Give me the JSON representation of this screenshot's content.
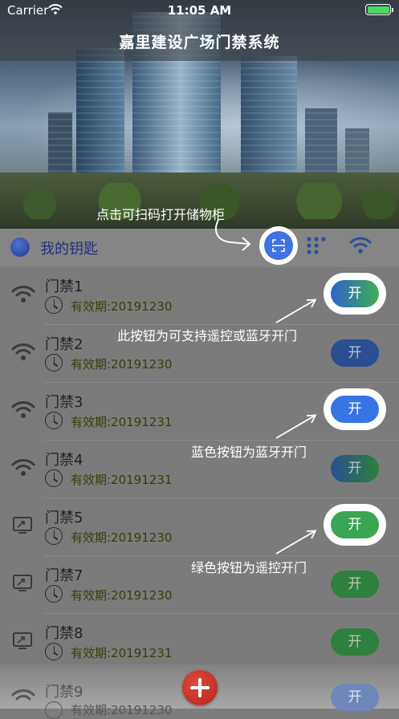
{
  "status_bar": {
    "carrier": "Carrier",
    "time": "11:05 AM"
  },
  "header": {
    "title": "嘉里建设广场门禁系统"
  },
  "tips": {
    "scan": "点击可扫码打开储物柜",
    "remote_or_bluetooth": "此按钮为可支持遥控或蓝牙开门",
    "bluetooth": "蓝色按钮为蓝牙开门",
    "remote": "绿色按钮为遥控开门"
  },
  "keys_header": {
    "label": "我的钥匙"
  },
  "open_label": "开",
  "keys": [
    {
      "name": "门禁1",
      "validity": "有效期:20191230",
      "icon": "wifi-icon",
      "button_color": "#3a8cc8"
    },
    {
      "name": "门禁2",
      "validity": "有效期:20191230",
      "icon": "wifi-icon",
      "button_color": "#2a4e8f"
    },
    {
      "name": "门禁3",
      "validity": "有效期:20191231",
      "icon": "wifi-icon",
      "button_color": "#3875e4"
    },
    {
      "name": "门禁4",
      "validity": "有效期:20191231",
      "icon": "wifi-icon",
      "button_color": "#29508f"
    },
    {
      "name": "门禁5",
      "validity": "有效期:20191230",
      "icon": "remote-screen-icon",
      "button_color": "#3aa552"
    },
    {
      "name": "门禁7",
      "validity": "有效期:20191230",
      "icon": "remote-screen-icon",
      "button_color": "#2f7f3d"
    },
    {
      "name": "门禁8",
      "validity": "有效期:20191231",
      "icon": "remote-screen-icon",
      "button_color": "#2f7f3d"
    },
    {
      "name": "门禁9",
      "validity": "有效期:20191230",
      "icon": "wifi-icon",
      "button_color": "#2a4e8f"
    }
  ]
}
